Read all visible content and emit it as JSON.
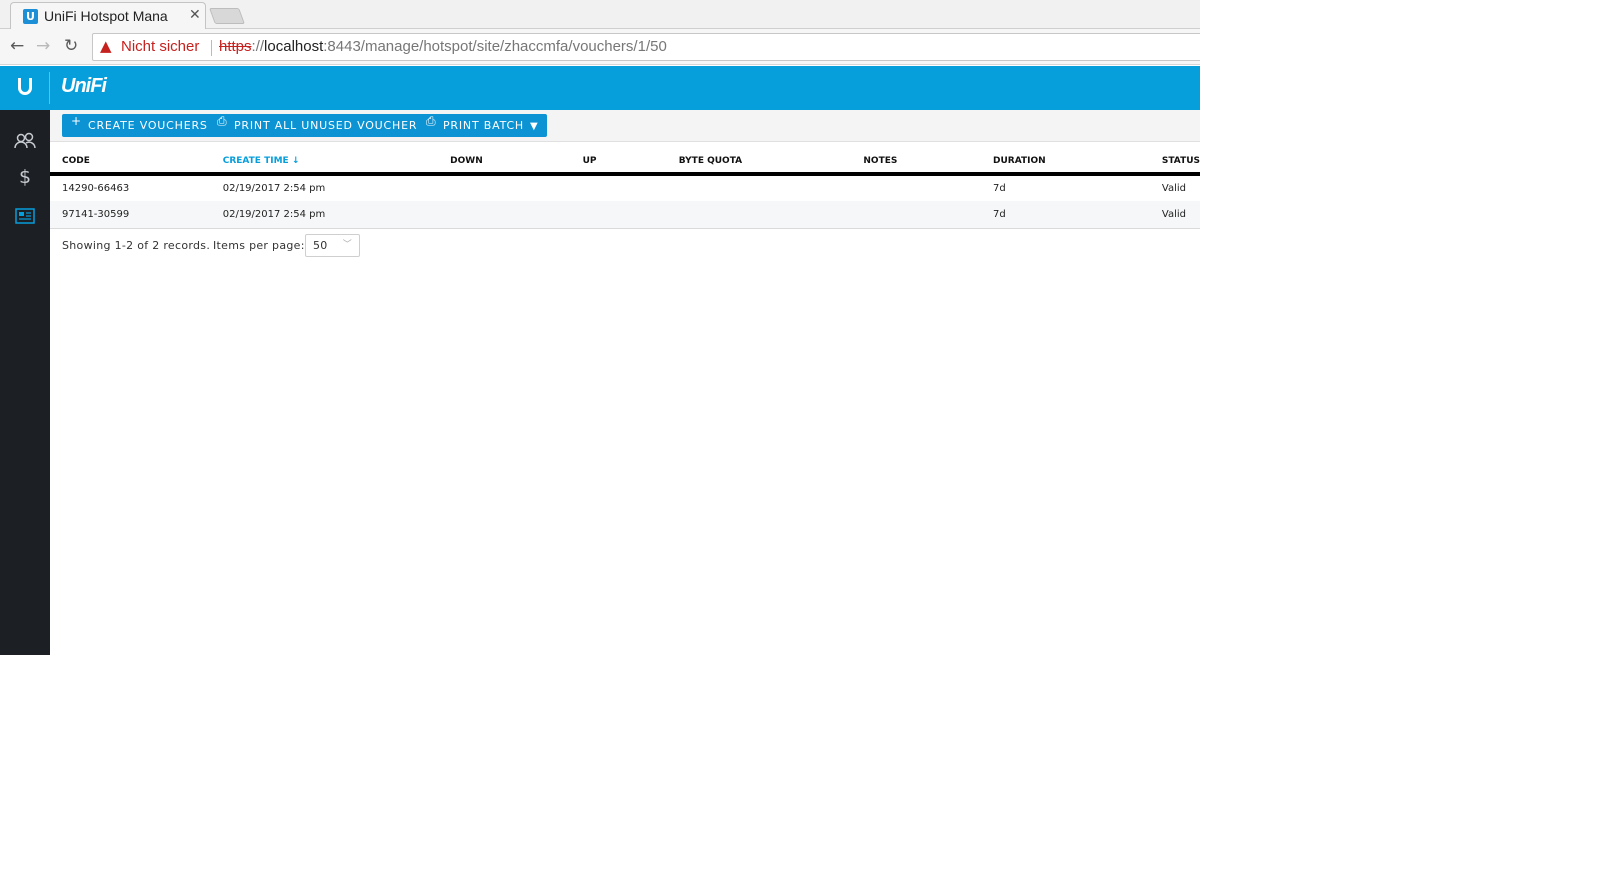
{
  "browser": {
    "tab_title": "UniFi Hotspot Mana",
    "tab_close": "✕",
    "warning_label": "Nicht sicher",
    "url_scheme": "https",
    "url_separator": "://",
    "url_host": "localhost",
    "url_path": ":8443/manage/hotspot/site/zhaccmfa/vouchers/1/50"
  },
  "app": {
    "logo_text": "UniFi",
    "accent_color": "#069edb",
    "sidebar_items": [
      {
        "name": "guests",
        "icon": "users-icon"
      },
      {
        "name": "payments",
        "icon": "dollar-icon"
      },
      {
        "name": "vouchers",
        "icon": "voucher-icon",
        "active": true
      }
    ]
  },
  "actions": {
    "create_label": "CREATE VOUCHERS",
    "print_unused_label": "PRINT ALL UNUSED VOUCHERS",
    "print_batch_label": "PRINT BATCH"
  },
  "table": {
    "headers": [
      "CODE",
      "CREATE TIME ↓",
      "DOWN",
      "UP",
      "BYTE QUOTA",
      "NOTES",
      "DURATION",
      "STATUS"
    ],
    "rows": [
      {
        "code": "14290-66463",
        "create_time": "02/19/2017 2:54 pm",
        "down": "",
        "up": "",
        "byte_quota": "",
        "notes": "",
        "duration": "7d",
        "status": "Valid"
      },
      {
        "code": "97141-30599",
        "create_time": "02/19/2017 2:54 pm",
        "down": "",
        "up": "",
        "byte_quota": "",
        "notes": "",
        "duration": "7d",
        "status": "Valid"
      }
    ]
  },
  "pager": {
    "summary": "Showing 1-2 of 2 records.",
    "items_per_page_label": "Items per page:",
    "items_per_page_value": "50"
  }
}
